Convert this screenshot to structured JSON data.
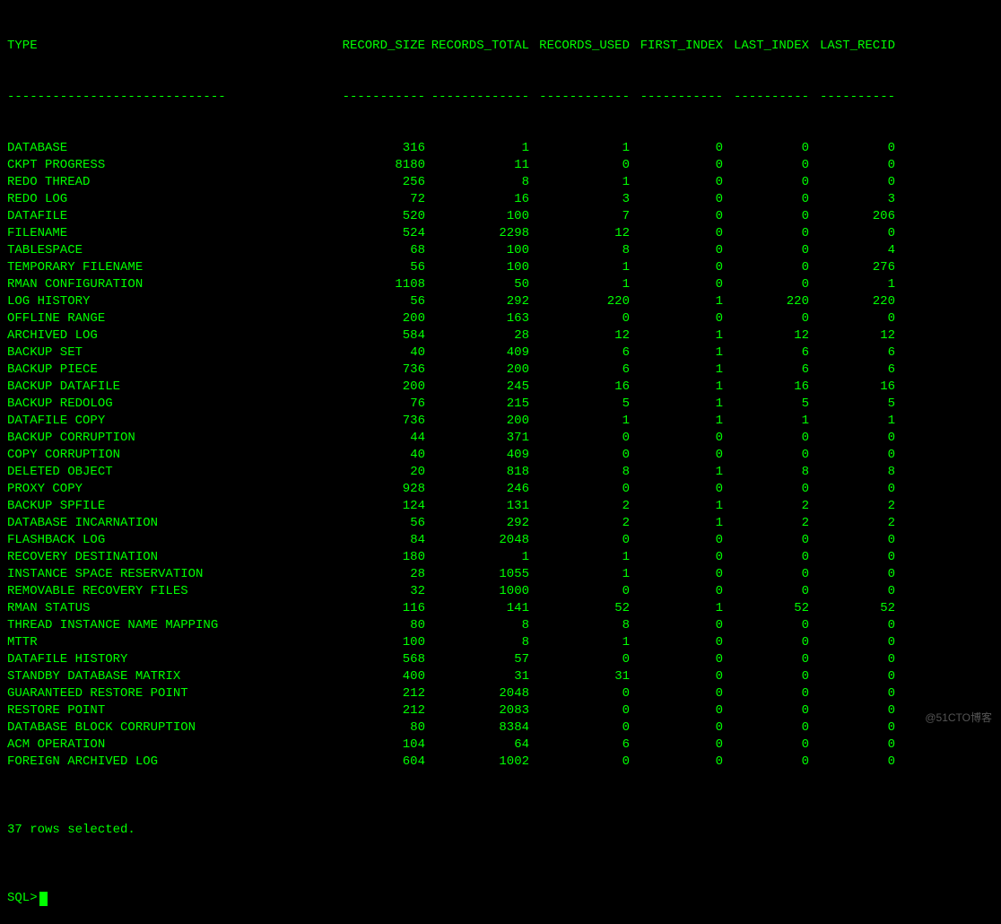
{
  "headers": {
    "type": "TYPE",
    "record_size": "RECORD_SIZE",
    "records_total": "RECORDS_TOTAL",
    "records_used": "RECORDS_USED",
    "first_index": "FIRST_INDEX",
    "last_index": "LAST_INDEX",
    "last_recid": "LAST_RECID"
  },
  "separators": {
    "type": "-----------------------------",
    "record_size": "-----------",
    "records_total": "-------------",
    "records_used": "------------",
    "first_index": "-----------",
    "last_index": "----------",
    "last_recid": "----------"
  },
  "rows": [
    {
      "type": "DATABASE",
      "record_size": "316",
      "records_total": "1",
      "records_used": "1",
      "first_index": "0",
      "last_index": "0",
      "last_recid": "0"
    },
    {
      "type": "CKPT PROGRESS",
      "record_size": "8180",
      "records_total": "11",
      "records_used": "0",
      "first_index": "0",
      "last_index": "0",
      "last_recid": "0"
    },
    {
      "type": "REDO THREAD",
      "record_size": "256",
      "records_total": "8",
      "records_used": "1",
      "first_index": "0",
      "last_index": "0",
      "last_recid": "0"
    },
    {
      "type": "REDO LOG",
      "record_size": "72",
      "records_total": "16",
      "records_used": "3",
      "first_index": "0",
      "last_index": "0",
      "last_recid": "3"
    },
    {
      "type": "DATAFILE",
      "record_size": "520",
      "records_total": "100",
      "records_used": "7",
      "first_index": "0",
      "last_index": "0",
      "last_recid": "206"
    },
    {
      "type": "FILENAME",
      "record_size": "524",
      "records_total": "2298",
      "records_used": "12",
      "first_index": "0",
      "last_index": "0",
      "last_recid": "0"
    },
    {
      "type": "TABLESPACE",
      "record_size": "68",
      "records_total": "100",
      "records_used": "8",
      "first_index": "0",
      "last_index": "0",
      "last_recid": "4"
    },
    {
      "type": "TEMPORARY FILENAME",
      "record_size": "56",
      "records_total": "100",
      "records_used": "1",
      "first_index": "0",
      "last_index": "0",
      "last_recid": "276"
    },
    {
      "type": "RMAN CONFIGURATION",
      "record_size": "1108",
      "records_total": "50",
      "records_used": "1",
      "first_index": "0",
      "last_index": "0",
      "last_recid": "1"
    },
    {
      "type": "LOG HISTORY",
      "record_size": "56",
      "records_total": "292",
      "records_used": "220",
      "first_index": "1",
      "last_index": "220",
      "last_recid": "220"
    },
    {
      "type": "OFFLINE RANGE",
      "record_size": "200",
      "records_total": "163",
      "records_used": "0",
      "first_index": "0",
      "last_index": "0",
      "last_recid": "0"
    },
    {
      "type": "ARCHIVED LOG",
      "record_size": "584",
      "records_total": "28",
      "records_used": "12",
      "first_index": "1",
      "last_index": "12",
      "last_recid": "12"
    },
    {
      "type": "BACKUP SET",
      "record_size": "40",
      "records_total": "409",
      "records_used": "6",
      "first_index": "1",
      "last_index": "6",
      "last_recid": "6"
    },
    {
      "type": "BACKUP PIECE",
      "record_size": "736",
      "records_total": "200",
      "records_used": "6",
      "first_index": "1",
      "last_index": "6",
      "last_recid": "6"
    },
    {
      "type": "BACKUP DATAFILE",
      "record_size": "200",
      "records_total": "245",
      "records_used": "16",
      "first_index": "1",
      "last_index": "16",
      "last_recid": "16"
    },
    {
      "type": "BACKUP REDOLOG",
      "record_size": "76",
      "records_total": "215",
      "records_used": "5",
      "first_index": "1",
      "last_index": "5",
      "last_recid": "5"
    },
    {
      "type": "DATAFILE COPY",
      "record_size": "736",
      "records_total": "200",
      "records_used": "1",
      "first_index": "1",
      "last_index": "1",
      "last_recid": "1"
    },
    {
      "type": "BACKUP CORRUPTION",
      "record_size": "44",
      "records_total": "371",
      "records_used": "0",
      "first_index": "0",
      "last_index": "0",
      "last_recid": "0"
    },
    {
      "type": "COPY CORRUPTION",
      "record_size": "40",
      "records_total": "409",
      "records_used": "0",
      "first_index": "0",
      "last_index": "0",
      "last_recid": "0"
    },
    {
      "type": "DELETED OBJECT",
      "record_size": "20",
      "records_total": "818",
      "records_used": "8",
      "first_index": "1",
      "last_index": "8",
      "last_recid": "8"
    },
    {
      "type": "PROXY COPY",
      "record_size": "928",
      "records_total": "246",
      "records_used": "0",
      "first_index": "0",
      "last_index": "0",
      "last_recid": "0"
    },
    {
      "type": "BACKUP SPFILE",
      "record_size": "124",
      "records_total": "131",
      "records_used": "2",
      "first_index": "1",
      "last_index": "2",
      "last_recid": "2"
    },
    {
      "type": "DATABASE INCARNATION",
      "record_size": "56",
      "records_total": "292",
      "records_used": "2",
      "first_index": "1",
      "last_index": "2",
      "last_recid": "2"
    },
    {
      "type": "FLASHBACK LOG",
      "record_size": "84",
      "records_total": "2048",
      "records_used": "0",
      "first_index": "0",
      "last_index": "0",
      "last_recid": "0"
    },
    {
      "type": "RECOVERY DESTINATION",
      "record_size": "180",
      "records_total": "1",
      "records_used": "1",
      "first_index": "0",
      "last_index": "0",
      "last_recid": "0"
    },
    {
      "type": "INSTANCE SPACE RESERVATION",
      "record_size": "28",
      "records_total": "1055",
      "records_used": "1",
      "first_index": "0",
      "last_index": "0",
      "last_recid": "0"
    },
    {
      "type": "REMOVABLE RECOVERY FILES",
      "record_size": "32",
      "records_total": "1000",
      "records_used": "0",
      "first_index": "0",
      "last_index": "0",
      "last_recid": "0"
    },
    {
      "type": "RMAN STATUS",
      "record_size": "116",
      "records_total": "141",
      "records_used": "52",
      "first_index": "1",
      "last_index": "52",
      "last_recid": "52"
    },
    {
      "type": "THREAD INSTANCE NAME MAPPING",
      "record_size": "80",
      "records_total": "8",
      "records_used": "8",
      "first_index": "0",
      "last_index": "0",
      "last_recid": "0"
    },
    {
      "type": "MTTR",
      "record_size": "100",
      "records_total": "8",
      "records_used": "1",
      "first_index": "0",
      "last_index": "0",
      "last_recid": "0"
    },
    {
      "type": "DATAFILE HISTORY",
      "record_size": "568",
      "records_total": "57",
      "records_used": "0",
      "first_index": "0",
      "last_index": "0",
      "last_recid": "0"
    },
    {
      "type": "STANDBY DATABASE MATRIX",
      "record_size": "400",
      "records_total": "31",
      "records_used": "31",
      "first_index": "0",
      "last_index": "0",
      "last_recid": "0"
    },
    {
      "type": "GUARANTEED RESTORE POINT",
      "record_size": "212",
      "records_total": "2048",
      "records_used": "0",
      "first_index": "0",
      "last_index": "0",
      "last_recid": "0"
    },
    {
      "type": "RESTORE POINT",
      "record_size": "212",
      "records_total": "2083",
      "records_used": "0",
      "first_index": "0",
      "last_index": "0",
      "last_recid": "0"
    },
    {
      "type": "DATABASE BLOCK CORRUPTION",
      "record_size": "80",
      "records_total": "8384",
      "records_used": "0",
      "first_index": "0",
      "last_index": "0",
      "last_recid": "0"
    },
    {
      "type": "ACM OPERATION",
      "record_size": "104",
      "records_total": "64",
      "records_used": "6",
      "first_index": "0",
      "last_index": "0",
      "last_recid": "0"
    },
    {
      "type": "FOREIGN ARCHIVED LOG",
      "record_size": "604",
      "records_total": "1002",
      "records_used": "0",
      "first_index": "0",
      "last_index": "0",
      "last_recid": "0"
    }
  ],
  "status": "37 rows selected.",
  "prompt": "SQL>",
  "watermark": "@51CTO博客"
}
